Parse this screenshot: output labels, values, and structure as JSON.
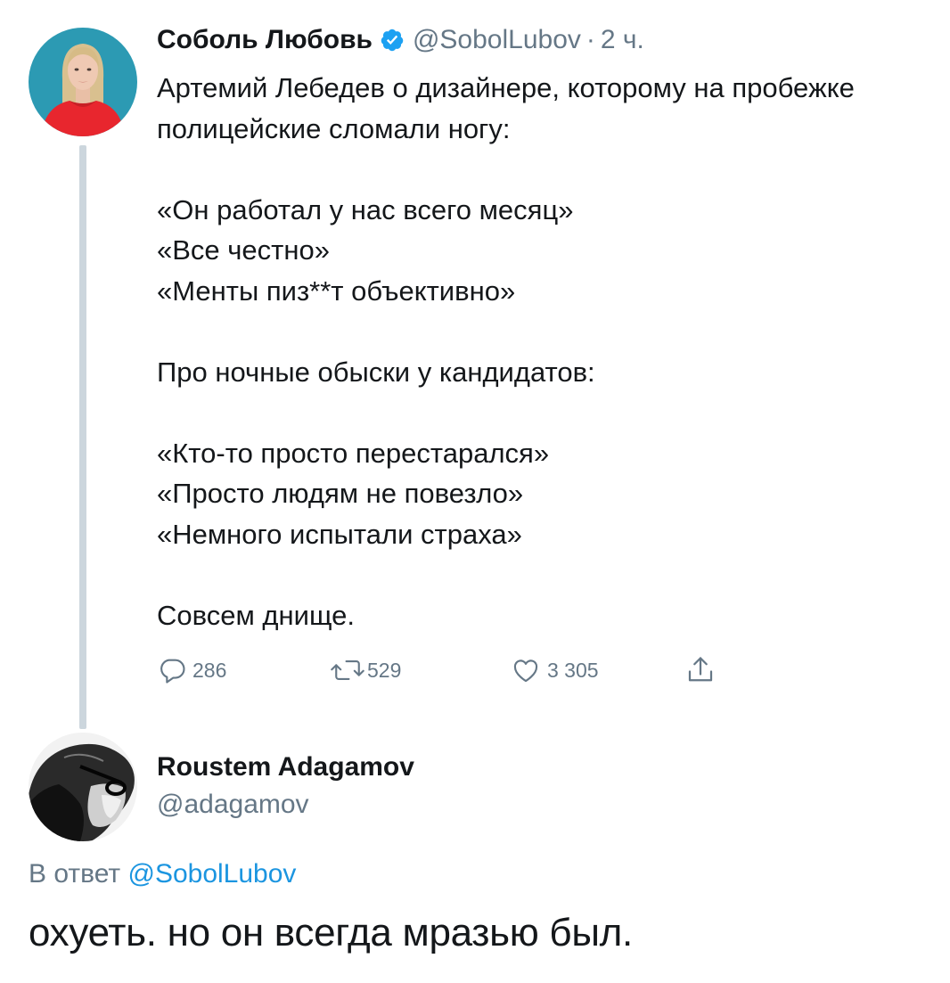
{
  "tweet": {
    "author_name": "Соболь Любовь",
    "author_handle": "@SobolLubov",
    "separator": "·",
    "time": "2 ч.",
    "lines": [
      "Артемий Лебедев о дизайнере, которому на пробежке",
      "полицейские сломали ногу:",
      "",
      "«Он работал у нас всего месяц»",
      "«Все честно»",
      "«Менты пиз**т объективно»",
      "",
      "Про ночные обыски у кандидатов:",
      "",
      "«Кто-то просто перестарался»",
      "«Просто людям не повезло»",
      "«Немного испытали страха»",
      "",
      "Совсем днище."
    ],
    "replies": "286",
    "retweets": "529",
    "likes": "3 305",
    "icons": {
      "reply": "reply-icon",
      "retweet": "retweet-icon",
      "like": "heart-icon",
      "share": "share-icon",
      "verified": "verified-badge-icon"
    }
  },
  "reply": {
    "author_name": "Roustem Adagamov",
    "author_handle": "@adagamov",
    "in_reply_to_label": "В ответ",
    "in_reply_to_handle": "@SobolLubov",
    "text": "охуеть. но он всегда мразью был."
  },
  "colors": {
    "text": "#14171a",
    "secondary": "#657786",
    "link": "#1b95e0",
    "verified": "#1da1f2",
    "thread_line": "#ccd6dd"
  }
}
